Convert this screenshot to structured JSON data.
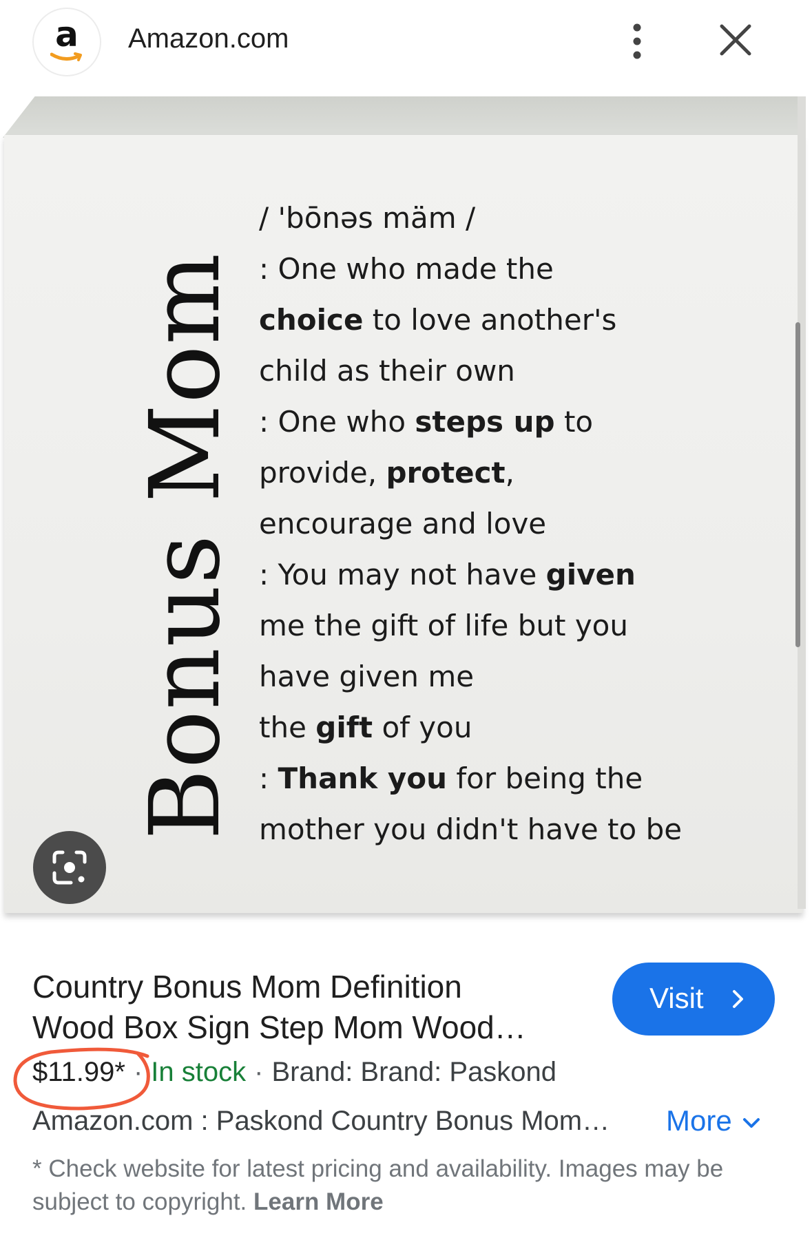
{
  "header": {
    "logo_letter": "a",
    "site_name": "Amazon.com",
    "menu_icon": "more-vertical-icon",
    "close_icon": "close-icon"
  },
  "product_image": {
    "vertical_title": "Bonus Mom",
    "definition_lines": [
      {
        "parts": [
          {
            "text": "/ 'bōnəs mäm /",
            "bold": false
          }
        ]
      },
      {
        "parts": [
          {
            "text": ": One who made the",
            "bold": false
          }
        ]
      },
      {
        "parts": [
          {
            "text": "choice",
            "bold": true
          },
          {
            "text": " to love another's",
            "bold": false
          }
        ]
      },
      {
        "parts": [
          {
            "text": "child as their own",
            "bold": false
          }
        ]
      },
      {
        "parts": [
          {
            "text": ": One who ",
            "bold": false
          },
          {
            "text": "steps up",
            "bold": true
          },
          {
            "text": " to",
            "bold": false
          }
        ]
      },
      {
        "parts": [
          {
            "text": "provide, ",
            "bold": false
          },
          {
            "text": "protect",
            "bold": true
          },
          {
            "text": ",",
            "bold": false
          }
        ]
      },
      {
        "parts": [
          {
            "text": "encourage and love",
            "bold": false
          }
        ]
      },
      {
        "parts": [
          {
            "text": ": You may not have ",
            "bold": false
          },
          {
            "text": "given",
            "bold": true
          }
        ]
      },
      {
        "parts": [
          {
            "text": "me the gift of life but you",
            "bold": false
          }
        ]
      },
      {
        "parts": [
          {
            "text": "have given me",
            "bold": false
          }
        ]
      },
      {
        "parts": [
          {
            "text": "the ",
            "bold": false
          },
          {
            "text": "gift",
            "bold": true
          },
          {
            "text": " of you",
            "bold": false
          }
        ]
      },
      {
        "parts": [
          {
            "text": ": ",
            "bold": false
          },
          {
            "text": "Thank you",
            "bold": true
          },
          {
            "text": " for being the",
            "bold": false
          }
        ]
      },
      {
        "parts": [
          {
            "text": "mother you didn't have to be",
            "bold": false
          }
        ]
      }
    ],
    "lens_icon": "google-lens-icon"
  },
  "product": {
    "title_line1": "Country Bonus Mom Definition",
    "title_line2": "Wood Box Sign Step Mom Wood…",
    "visit_label": "Visit",
    "price": "$11.99*",
    "separator": "·",
    "stock": "In stock",
    "brand": "Brand: Brand: Paskond",
    "source": "Amazon.com : Paskond Country Bonus Mom…",
    "more_label": "More",
    "disclaimer": "* Check website for latest pricing and availability. Images may be subject to copyright.",
    "learn_more": "Learn More"
  },
  "colors": {
    "link_blue": "#1a73e8",
    "stock_green": "#188038",
    "annotation_red": "#f05a3a"
  }
}
